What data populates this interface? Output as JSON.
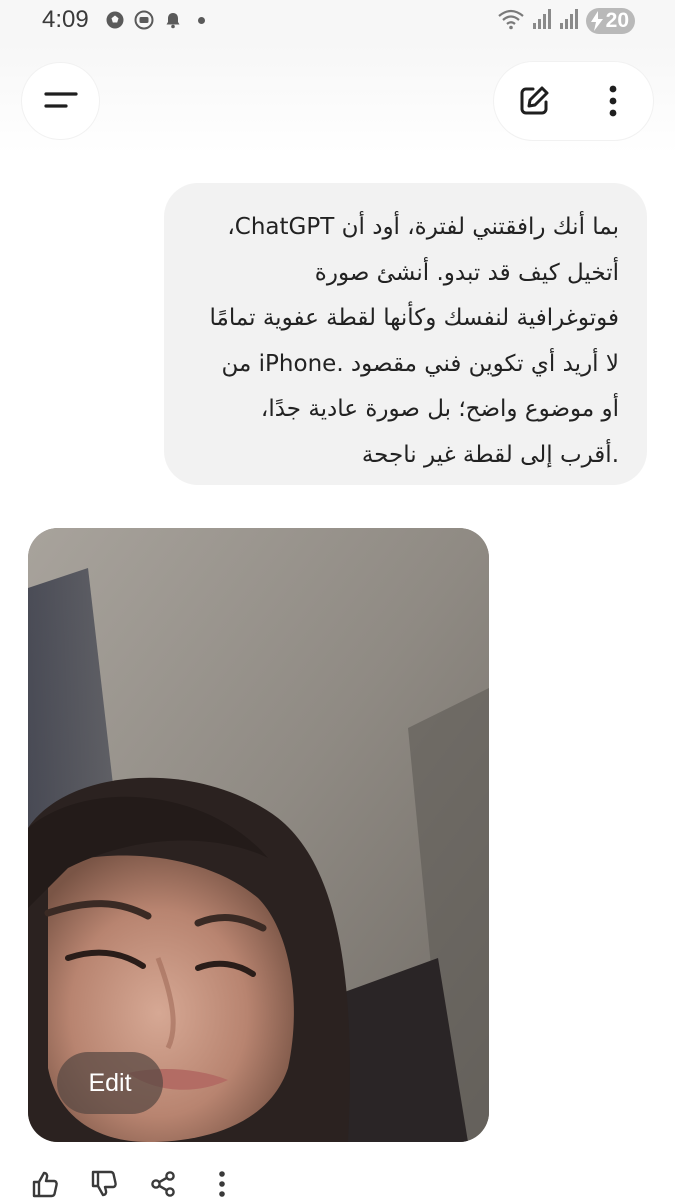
{
  "status_bar": {
    "time": "4:09",
    "battery_level": "20",
    "left_icons": [
      "soccer-ball-icon",
      "media-icon",
      "notification-bell-icon",
      "dot-icon"
    ],
    "right_icons": [
      "wifi-icon",
      "signal-icon",
      "signal-icon",
      "battery-charging-icon"
    ]
  },
  "header": {
    "menu_icon": "menu-icon",
    "new_chat_icon": "edit-icon",
    "more_icon": "more-vertical-icon"
  },
  "conversation": {
    "user_message_lines": [
      "بما أنك رافقتني لفترة، أود أن ChatGPT،",
      "أتخيل كيف قد تبدو. أنشئ صورة",
      "فوتوغرافية لنفسك وكأنها لقطة عفوية تمامًا",
      "لا أريد أي تكوين فني مقصود .iPhone من",
      "أو موضوع واضح؛ بل صورة عادية جدًا،",
      ".أقرب إلى لقطة غير ناجحة"
    ],
    "generated_image": {
      "edit_label": "Edit"
    },
    "actions": [
      "thumbs-up-icon",
      "thumbs-down-icon",
      "share-icon",
      "more-vertical-icon"
    ]
  }
}
